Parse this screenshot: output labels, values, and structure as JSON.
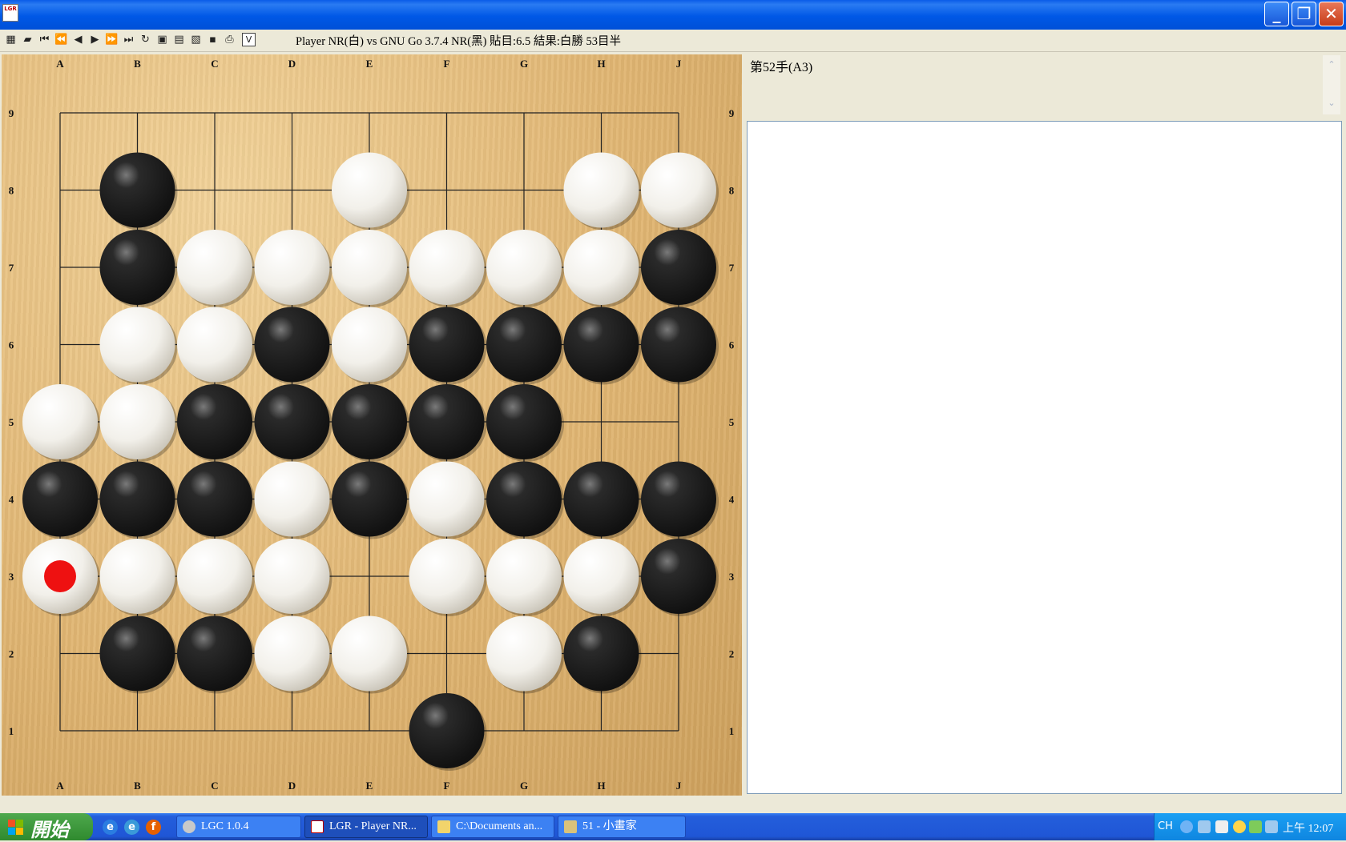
{
  "window": {
    "app_icon_text": "LGR",
    "minimize_glyph": "_",
    "maximize_glyph": "❐",
    "close_glyph": "✕"
  },
  "toolbar": {
    "icons": [
      "board-icon",
      "open-folder-icon",
      "first-move-icon",
      "back-ten-icon",
      "back-icon",
      "forward-icon",
      "forward-ten-icon",
      "last-move-icon",
      "refresh-icon",
      "save-icon",
      "export-icon",
      "edit-icon",
      "disk-icon",
      "print-icon"
    ],
    "v_label": "V",
    "game_title": "Player NR(白) vs GNU Go 3.7.4 NR(黑) 貼目:6.5 結果:白勝 53目半"
  },
  "board": {
    "size": 9,
    "col_labels": [
      "A",
      "B",
      "C",
      "D",
      "E",
      "F",
      "G",
      "H",
      "J"
    ],
    "row_labels": [
      "9",
      "8",
      "7",
      "6",
      "5",
      "4",
      "3",
      "2",
      "1"
    ],
    "rows": [
      ".........",
      ".B..W..WW",
      ".BWWWWWWB",
      ".WWBWBBBB",
      "WWBBBBB..",
      "BBBWBWBBB",
      "WWWW.WWWB",
      ".BBWW.WB.",
      ".....B..."
    ],
    "last_move": "A3",
    "last_move_marker_color": "#ee1111",
    "black_stone_color": "#111111",
    "white_stone_color": "#f2f0ea"
  },
  "panel": {
    "move_label": "第52手(A3)",
    "scroll_up": "⌃",
    "scroll_down": "⌄",
    "comment": ""
  },
  "taskbar": {
    "start_label": "開始",
    "quick_launch": [
      "ie-icon",
      "outlook-express-icon",
      "firefox-icon"
    ],
    "tasks": [
      {
        "label": "LGC 1.0.4",
        "icon": "lgc-icon",
        "active": false
      },
      {
        "label": "LGR - Player NR...",
        "icon": "lgr-icon",
        "active": true
      },
      {
        "label": "C:\\Documents an...",
        "icon": "folder-icon",
        "active": false
      },
      {
        "label": "51 - 小畫家",
        "icon": "paint-icon",
        "active": false
      }
    ],
    "lang": "CH",
    "clock": "上午 12:07"
  }
}
